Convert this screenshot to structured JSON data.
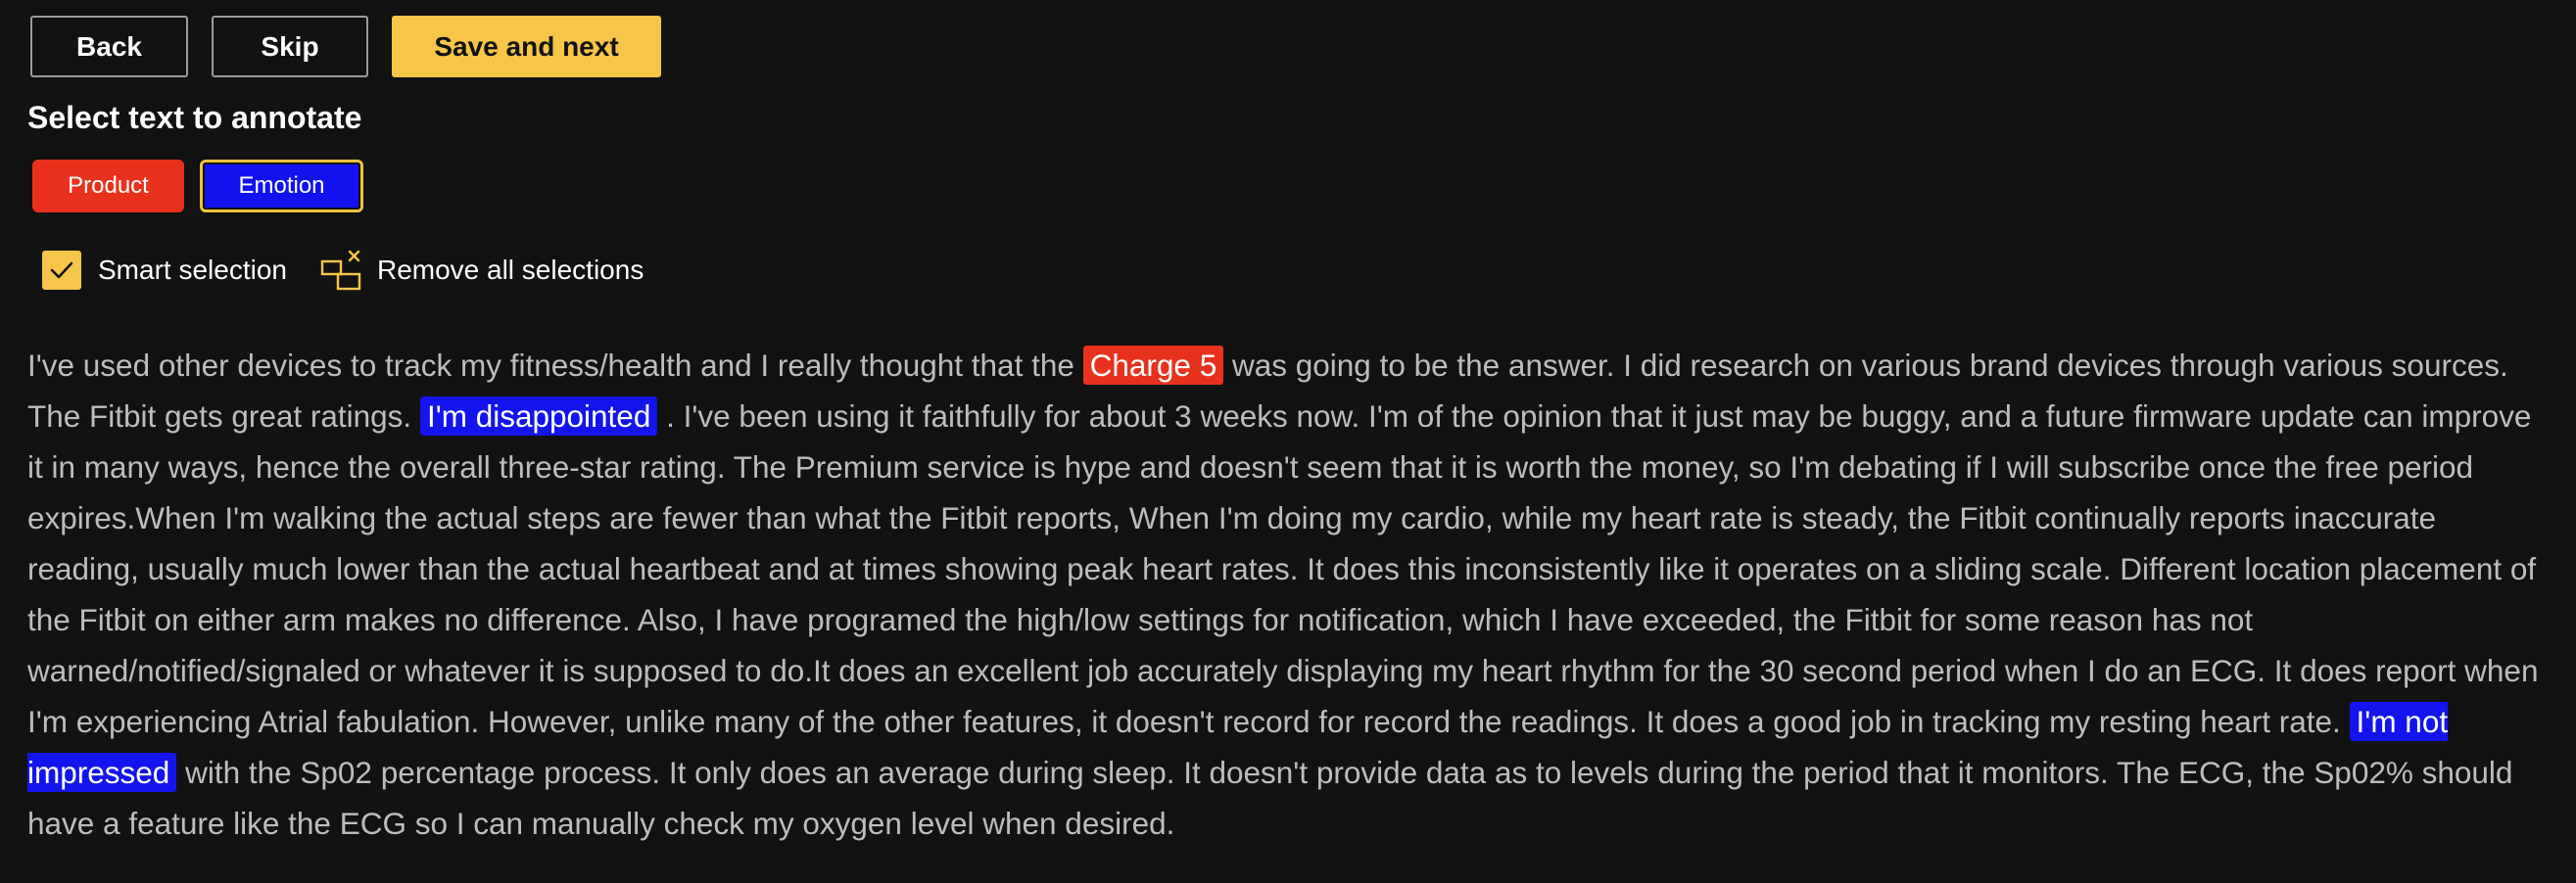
{
  "toolbar": {
    "back_label": "Back",
    "skip_label": "Skip",
    "save_label": "Save and next"
  },
  "heading": "Select text to annotate",
  "labels": [
    {
      "name": "Product",
      "color": "#e8321e",
      "selected": false
    },
    {
      "name": "Emotion",
      "color": "#1212f0",
      "selected": true
    }
  ],
  "options": {
    "smart_selection_label": "Smart selection",
    "smart_selection_checked": true,
    "remove_all_label": "Remove all selections"
  },
  "colors": {
    "background": "#121212",
    "accent": "#f7c548",
    "product": "#e8321e",
    "emotion": "#1212f0",
    "text": "#bdbdbd"
  },
  "icons": {
    "checkbox": "check-icon",
    "remove": "remove-selections-icon"
  },
  "review": {
    "segments": [
      {
        "text": "I've used other devices to track my fitness/health and I really thought that the "
      },
      {
        "text": "Charge 5",
        "label": "Product"
      },
      {
        "text": " was going to be the answer. I did research on various brand devices through various sources. The Fitbit gets great ratings. "
      },
      {
        "text": "I'm disappointed",
        "label": "Emotion"
      },
      {
        "text": ". I've been using it faithfully for about 3 weeks now. I'm of the opinion that it just may be buggy, and a future firmware update can improve it in many ways, hence the overall three-star rating. The Premium service is hype and doesn't seem that it is worth the money, so I'm debating if I will subscribe once the free period expires.When I'm walking the actual steps are fewer than what the Fitbit reports, When I'm doing my cardio, while my heart rate is steady, the Fitbit continually reports inaccurate reading, usually much lower than the actual heartbeat and at times showing peak heart rates. It does this inconsistently like it operates on a sliding scale. Different location placement of the Fitbit on either arm makes no difference. Also, I have programed the high/low settings for notification, which I have exceeded, the Fitbit for some reason has not warned/notified/signaled or whatever it is supposed to do.It does an excellent job accurately displaying my heart rhythm for the 30 second period when I do an ECG. It does report when I'm experiencing Atrial fabulation. However, unlike many of the other features, it doesn't record for record the readings. It does a good job in tracking my resting heart rate. "
      },
      {
        "text": "I'm not impressed",
        "label": "Emotion"
      },
      {
        "text": " with the Sp02 percentage process. It only does an average during sleep. It doesn't provide data as to levels during the period that it monitors. The ECG, the Sp02% should have a feature like the ECG so I can manually check my oxygen level when desired."
      }
    ]
  }
}
